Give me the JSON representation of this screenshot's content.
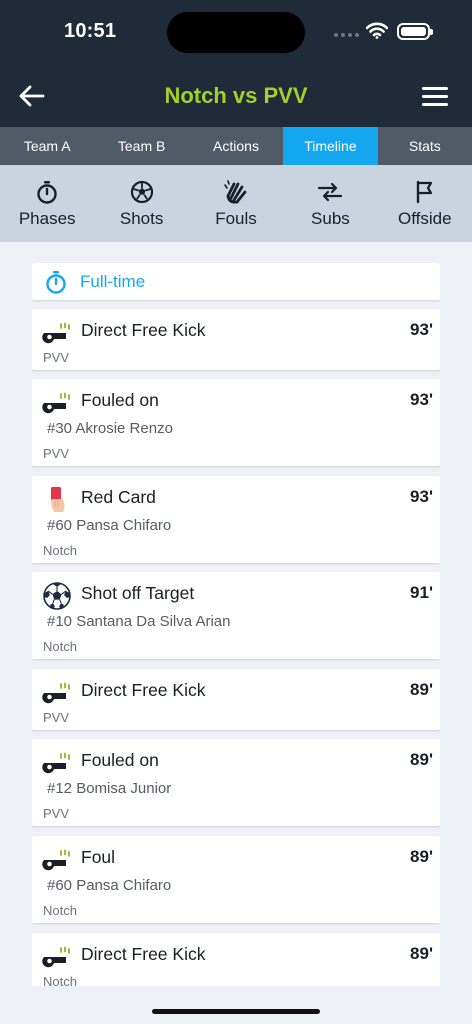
{
  "status_bar": {
    "time": "10:51"
  },
  "header": {
    "title": "Notch vs PVV"
  },
  "tabs": [
    {
      "label": "Team A",
      "active": false
    },
    {
      "label": "Team B",
      "active": false
    },
    {
      "label": "Actions",
      "active": false
    },
    {
      "label": "Timeline",
      "active": true
    },
    {
      "label": "Stats",
      "active": false
    }
  ],
  "filters": [
    {
      "label": "Phases",
      "icon": "stopwatch-icon"
    },
    {
      "label": "Shots",
      "icon": "soccer-ball-icon"
    },
    {
      "label": "Fouls",
      "icon": "hand-icon"
    },
    {
      "label": "Subs",
      "icon": "swap-arrows-icon"
    },
    {
      "label": "Offside",
      "icon": "flag-icon"
    }
  ],
  "phase_marker": {
    "label": "Full-time",
    "icon": "stopwatch-icon"
  },
  "events": [
    {
      "icon": "whistle-icon",
      "title": "Direct Free Kick",
      "minute": "93'",
      "player": "",
      "team": "PVV"
    },
    {
      "icon": "whistle-icon",
      "title": "Fouled on",
      "minute": "93'",
      "player": "#30 Akrosie Renzo",
      "team": "PVV"
    },
    {
      "icon": "red-card-icon",
      "title": "Red Card",
      "minute": "93'",
      "player": "#60 Pansa Chifaro",
      "team": "Notch"
    },
    {
      "icon": "soccer-ball-icon",
      "title": "Shot off Target",
      "minute": "91'",
      "player": "#10 Santana Da Silva Arian",
      "team": "Notch"
    },
    {
      "icon": "whistle-icon",
      "title": "Direct Free Kick",
      "minute": "89'",
      "player": "",
      "team": "PVV"
    },
    {
      "icon": "whistle-icon",
      "title": "Fouled on",
      "minute": "89'",
      "player": "#12 Bomisa Junior",
      "team": "PVV"
    },
    {
      "icon": "whistle-icon",
      "title": "Foul",
      "minute": "89'",
      "player": "#60 Pansa Chifaro",
      "team": "Notch"
    },
    {
      "icon": "whistle-icon",
      "title": "Direct Free Kick",
      "minute": "89'",
      "player": "",
      "team": "Notch"
    }
  ],
  "colors": {
    "header_bg": "#1f2b38",
    "title": "#a3d12a",
    "accent": "#14a7f0",
    "tab_bar": "#515b67",
    "filter_bar": "#c9d4e0"
  }
}
